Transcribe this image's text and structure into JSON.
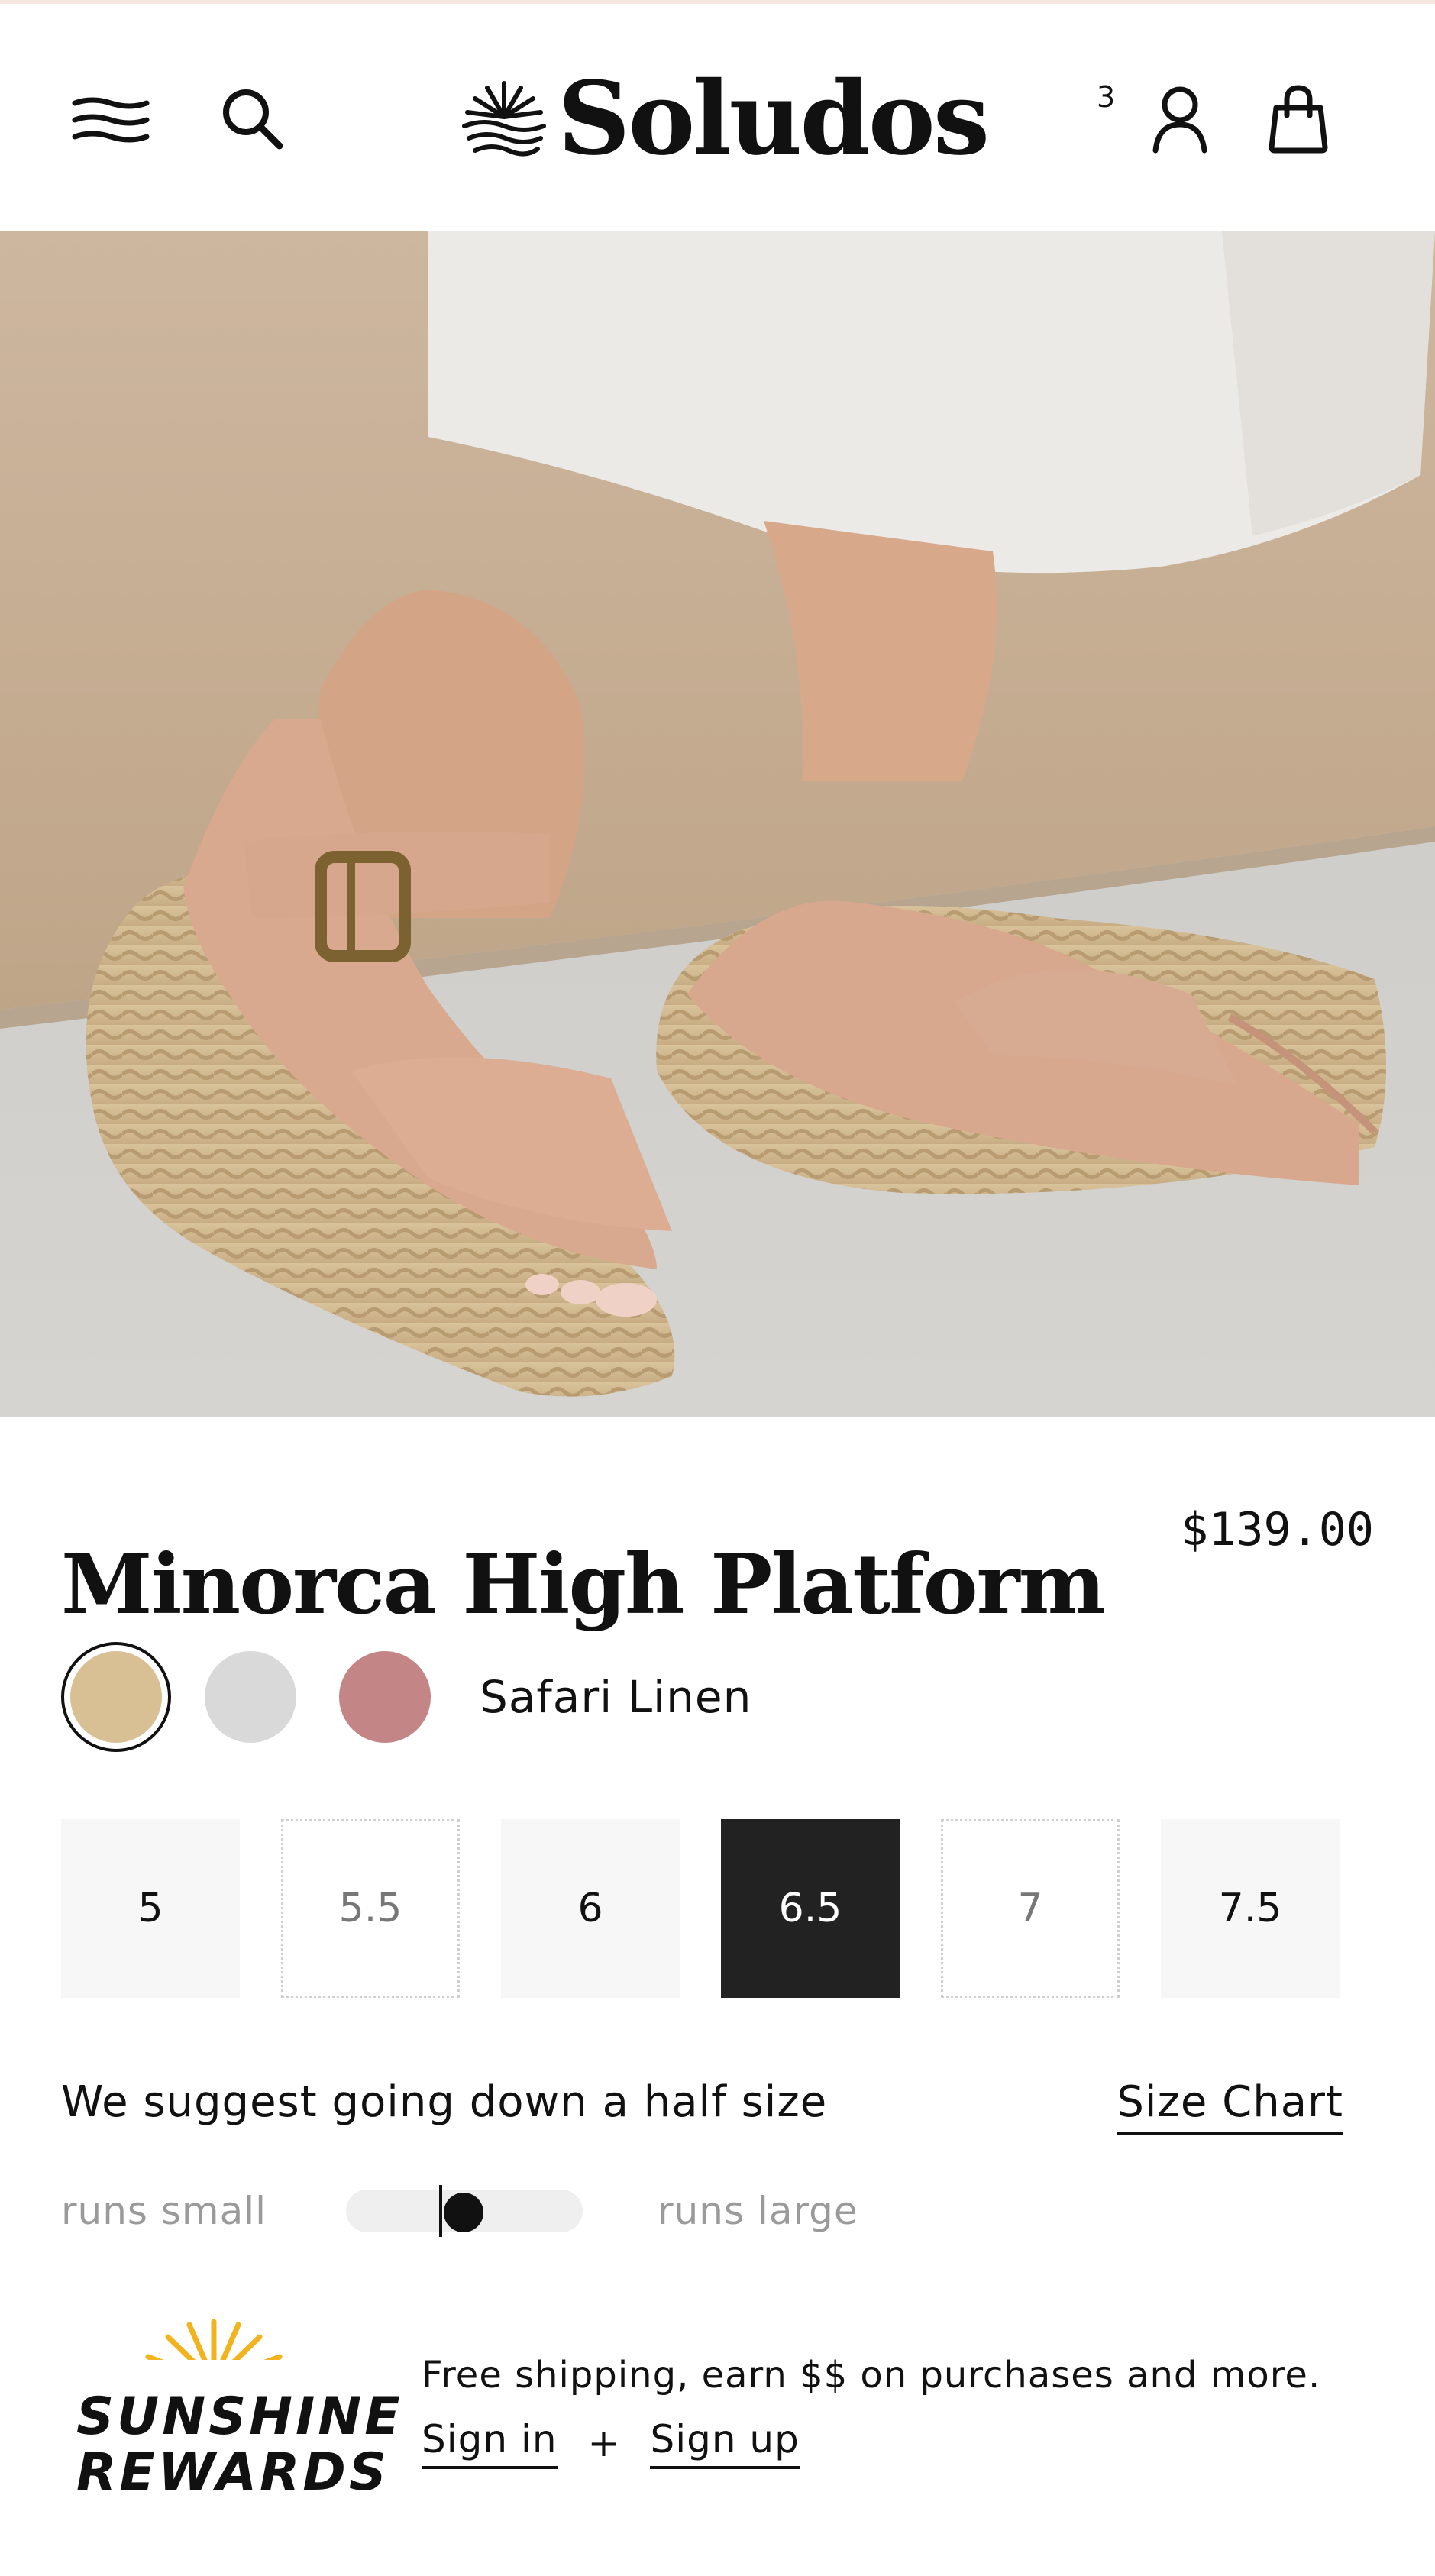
{
  "header": {
    "brand": "Soludos",
    "account_badge": "3",
    "icons": [
      "menu-icon",
      "search-icon",
      "sun-logo-icon",
      "account-icon",
      "shopping-bag-icon"
    ]
  },
  "gallery": {
    "dot_count": 5,
    "active_index": 0
  },
  "product": {
    "title": "Minorca High Platform",
    "price": "$139.00",
    "selected_color": "Safari Linen",
    "colors": [
      {
        "hex": "#d8bf94",
        "selected": true
      },
      {
        "hex": "#d9d9d9",
        "selected": false
      },
      {
        "hex": "#c38585",
        "selected": false
      }
    ],
    "sizes": [
      {
        "label": "5",
        "state": "available"
      },
      {
        "label": "5.5",
        "state": "unavailable"
      },
      {
        "label": "6",
        "state": "available"
      },
      {
        "label": "6.5",
        "state": "selected"
      },
      {
        "label": "7",
        "state": "unavailable"
      },
      {
        "label": "7.5",
        "state": "available"
      }
    ],
    "fit": {
      "suggestion": "We suggest going down a half size",
      "size_chart": "Size Chart",
      "runs_small": "runs small",
      "runs_large": "runs large",
      "value_percent": 40
    }
  },
  "rewards": {
    "line1": "SUNSHINE",
    "line2": "REWARDS",
    "perk": "Free shipping, earn $$ on purchases and more.",
    "sign_in": "Sign in",
    "plus": "+",
    "sign_up": "Sign up"
  }
}
